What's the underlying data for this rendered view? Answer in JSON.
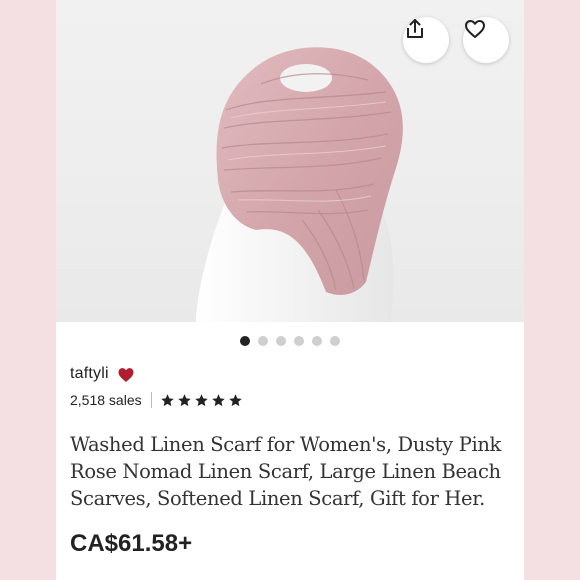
{
  "listing": {
    "shop_name": "taftyli",
    "sales": "2,518 sales",
    "rating_stars": 5,
    "title": "Washed Linen Scarf for Women's, Dusty Pink Rose Nomad Linen Scarf, Large Linen Beach Scarves, Softened Linen Scarf, Gift for Her.",
    "price": "CA$61.58+"
  },
  "gallery": {
    "image_count": 6,
    "active_index": 0
  },
  "icons": {
    "share": "share-icon",
    "favorite": "heart-icon",
    "star_seller": "heart-filled-icon"
  },
  "colors": {
    "background": "#f4dfe2",
    "scarf": "#d8aeb2",
    "heart": "#b01e2f",
    "text": "#222222"
  }
}
